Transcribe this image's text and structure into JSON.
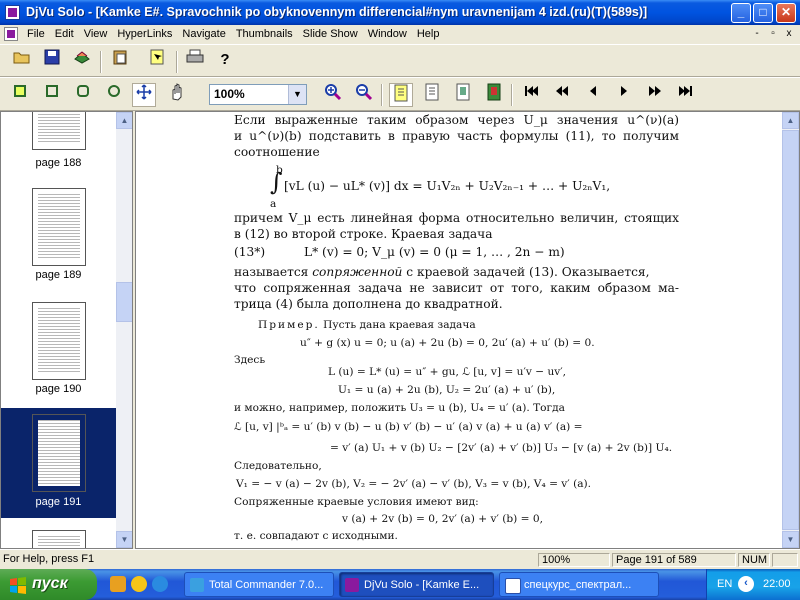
{
  "window": {
    "title": "DjVu Solo - [Kamke E#. Spravochnik po obyknovennym differencial#nym uravnenijam 4 izd.(ru)(T)(589s)]",
    "min_glyph": "_",
    "max_glyph": "□",
    "close_glyph": "✕"
  },
  "menu": {
    "items": [
      "File",
      "Edit",
      "View",
      "HyperLinks",
      "Navigate",
      "Thumbnails",
      "Slide Show",
      "Window",
      "Help"
    ],
    "mdi_min": "-",
    "mdi_restore": "▫",
    "mdi_close": "x"
  },
  "toolbar": {
    "zoom_value": "100%",
    "icons_row1": [
      "open-icon",
      "save-icon",
      "export-icon",
      "paste-icon",
      "select-icon",
      "print-icon",
      "help-icon"
    ],
    "icons_row2": [
      "zoom-fit-icon",
      "zoom-width-icon",
      "zoom-rect-icon",
      "zoom-select-icon",
      "pan-icon",
      "hand-icon",
      "zoom-in-icon",
      "zoom-out-icon",
      "page-layout-icon",
      "page-continuous-icon",
      "page-single-icon",
      "page-facing-icon",
      "first-page-icon",
      "prev-10-icon",
      "prev-page-icon",
      "next-page-icon",
      "next-10-icon",
      "last-page-icon"
    ]
  },
  "thumbnails": {
    "pages": [
      {
        "label": "page 188",
        "selected": false
      },
      {
        "label": "page 189",
        "selected": false
      },
      {
        "label": "page 190",
        "selected": false
      },
      {
        "label": "page 191",
        "selected": true
      },
      {
        "label": "",
        "selected": false
      }
    ]
  },
  "document": {
    "lines": {
      "l1": "Если выраженные таким образом через U_μ значения u^(ν)(a)",
      "l2": "и u^(ν)(b) подставить в правую часть формулы (11), то получим",
      "l3": "соотношение",
      "int_upper": "b",
      "int_lower": "a",
      "eq1": "[vL (u) − uL* (v)] dx = U₁V₂ₙ + U₂V₂ₙ₋₁ + … + U₂ₙV₁,",
      "l4": "причем V_μ есть линейная форма относительно величин, стоящих",
      "l5": "в (12) во второй строке. Краевая задача",
      "eq2": "L* (v) = 0;   V_μ (v) = 0      (μ = 1, … , 2n − m)",
      "eq2_no": "(13*)",
      "l6a": "называется ",
      "l6b": "сопряженной",
      "l6c": " с краевой задачей (13). Оказывается,",
      "l7": "что сопряженная задача не зависит от того, каким образом ма-",
      "l8": "трица (4) была дополнена до квадратной.",
      "ex_title": "Пример.",
      "ex_text": " Пусть дана краевая задача",
      "eq3": "u″ + g (x) u = 0;   u (a) + 2u (b) = 0,   2u′ (a) + u′ (b) = 0.",
      "here": "Здесь",
      "eq4": "L (u) = L* (u) = u″ + gu,   ℒ [u, v] = u′v − uv′,",
      "eq5": "U₁ = u (a) + 2u (b),   U₂ = 2u′ (a) + u′ (b),",
      "l9": "и можно, например, положить U₃ = u (b), U₄ = u′ (a). Тогда",
      "eq6": "ℒ [u, v] |ᵇₐ = u′ (b) v (b) − u (b) v′ (b) − u′ (a) v (a) + u (a) v′ (a) =",
      "eq7": "= v′ (a) U₁ + v (b) U₂ − [2v′ (a) + v′ (b)] U₃ − [v (a) + 2v (b)] U₄.",
      "cons": "Следовательно,",
      "eq8": "V₁ = − v (a) − 2v (b),   V₂ = − 2v′ (a) − v′ (b),   V₃ = v (b),   V₄ = v′ (a).",
      "adj": "Сопряженные краевые условия имеют вид:",
      "eq9": "v (a) + 2v (b) = 0,   2v′ (a) + v′ (b) = 0,",
      "last": "т. е. совпадают с исходными."
    }
  },
  "status": {
    "help": "For Help, press F1",
    "zoom": "100%",
    "page": "Page 191 of 589",
    "num": "NUM"
  },
  "taskbar": {
    "start_label": "пуск",
    "tasks": [
      {
        "label": "Total Commander 7.0...",
        "active": false
      },
      {
        "label": "DjVu Solo - [Kamke E...",
        "active": true
      },
      {
        "label": "спецкурс_спектрал...",
        "active": false
      }
    ],
    "lang": "EN",
    "clock": "22:00"
  },
  "colors": {
    "titlebar": "#0053e0",
    "selection": "#0a246a",
    "start": "#3c9b33",
    "taskbar": "#245edb"
  }
}
